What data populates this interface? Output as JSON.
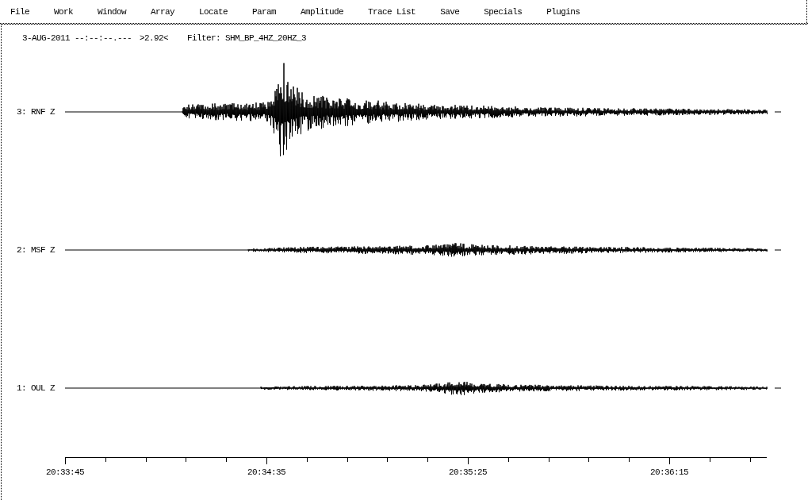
{
  "menu": [
    "File",
    "Work",
    "Window",
    "Array",
    "Locate",
    "Param",
    "Amplitude",
    "Trace List",
    "Save",
    "Specials",
    "Plugins"
  ],
  "header": {
    "datetime": "3-AUG-2011 --:--:--.---",
    "scale": ">2.92<",
    "filter": "Filter: SHM_BP_4HZ_20HZ_3"
  },
  "traces": [
    {
      "label": "3: RNF Z"
    },
    {
      "label": "2: MSF Z"
    },
    {
      "label": "1: OUL Z"
    }
  ],
  "time_axis": {
    "labels": [
      "20:33:45",
      "20:34:35",
      "20:35:25",
      "20:36:15"
    ]
  }
}
